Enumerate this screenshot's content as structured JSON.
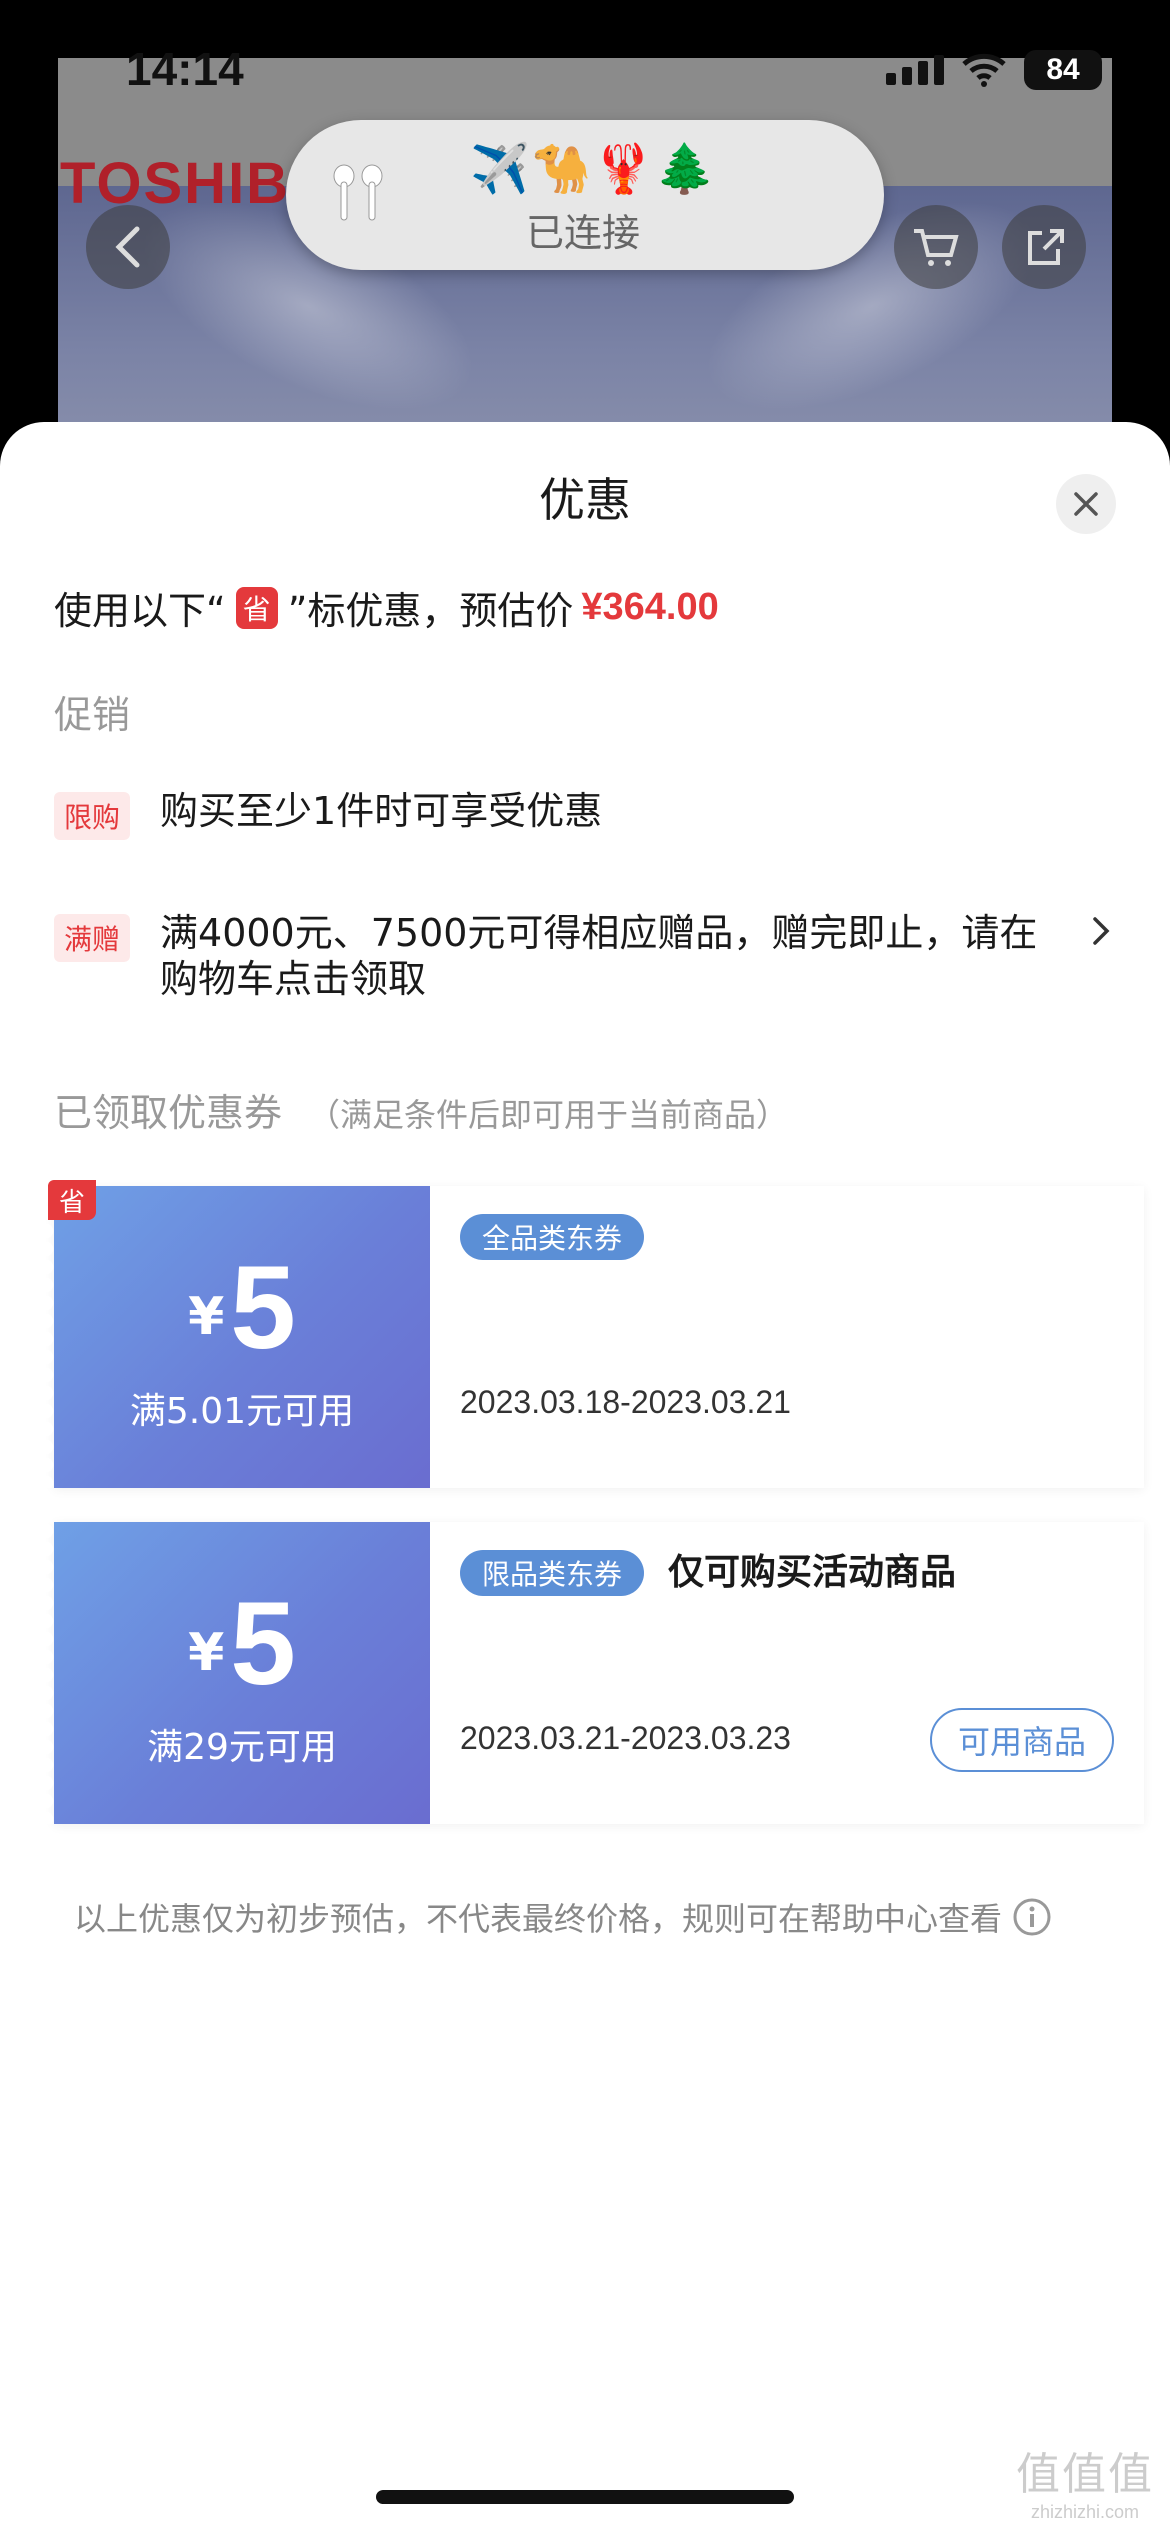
{
  "status_bar": {
    "time": "14:14",
    "battery": "84"
  },
  "background_app": {
    "brand": "TOSHIBA"
  },
  "airpods_popup": {
    "emojis": "✈️🐪🦞🌲",
    "status": "已连接"
  },
  "sheet": {
    "title": "优惠",
    "summary": {
      "prefix": "使用以下“",
      "badge": "省",
      "middle": "”标优惠，预估价",
      "price": "¥364.00"
    },
    "promotions_label": "促销",
    "promotions": [
      {
        "tag": "限购",
        "text": "购买至少1件时可享受优惠"
      },
      {
        "tag": "满赠",
        "text": "满4000元、7500元可得相应赠品，赠完即止，请在购物车点击领取"
      }
    ],
    "coupons_heading": "已领取优惠券",
    "coupons_note": "（满足条件后即可用于当前商品）",
    "coupons": [
      {
        "corner": "省",
        "currency": "¥",
        "amount": "5",
        "threshold": "满5.01元可用",
        "type": "全品类东券",
        "desc": "",
        "dates": "2023.03.18-2023.03.21",
        "button": ""
      },
      {
        "corner": "",
        "currency": "¥",
        "amount": "5",
        "threshold": "满29元可用",
        "type": "限品类东券",
        "desc": "仅可购买活动商品",
        "dates": "2023.03.21-2023.03.23",
        "button": "可用商品"
      }
    ],
    "disclaimer": "以上优惠仅为初步预估，不代表最终价格，规则可在帮助中心查看"
  },
  "watermark": {
    "logo": "值值值",
    "url": "zhizhizhi.com"
  },
  "colors": {
    "accent_red": "#e4393c",
    "coupon_blue": "#6a7fd8",
    "tag_blue": "#5b8fd6"
  }
}
